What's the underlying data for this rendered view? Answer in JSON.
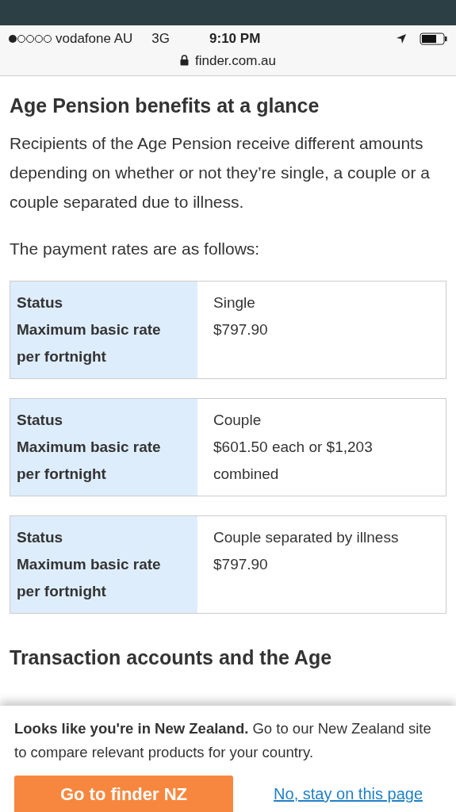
{
  "status_bar": {
    "carrier": "vodafone AU",
    "network": "3G",
    "time": "9:10 PM"
  },
  "address_bar": {
    "url": "finder.com.au"
  },
  "article": {
    "title": "Age Pension benefits at a glance",
    "paragraphs": [
      "Recipients of the Age Pension receive different amounts depending on whether or not they’re single, a couple or a couple separated due to illness.",
      "The payment rates are as follows:"
    ],
    "tables": [
      {
        "rows": [
          {
            "label": "Status",
            "value": "Single"
          },
          {
            "label": "Maximum basic rate per fortnight",
            "value": "$797.90"
          }
        ]
      },
      {
        "rows": [
          {
            "label": "Status",
            "value": "Couple"
          },
          {
            "label": "Maximum basic rate per fortnight",
            "value": "$601.50 each or $1,203 combined"
          }
        ]
      },
      {
        "rows": [
          {
            "label": "Status",
            "value": "Couple separated by illness"
          },
          {
            "label": "Maximum basic rate per fortnight",
            "value": "$797.90"
          }
        ]
      }
    ],
    "next_heading": "Transaction accounts and the Age"
  },
  "banner": {
    "message": "**Looks like you're in New Zealand.** Go to our New Zealand site to compare relevant products for your country.",
    "primary_button": "Go to finder NZ",
    "link": "No, stay on this page"
  }
}
